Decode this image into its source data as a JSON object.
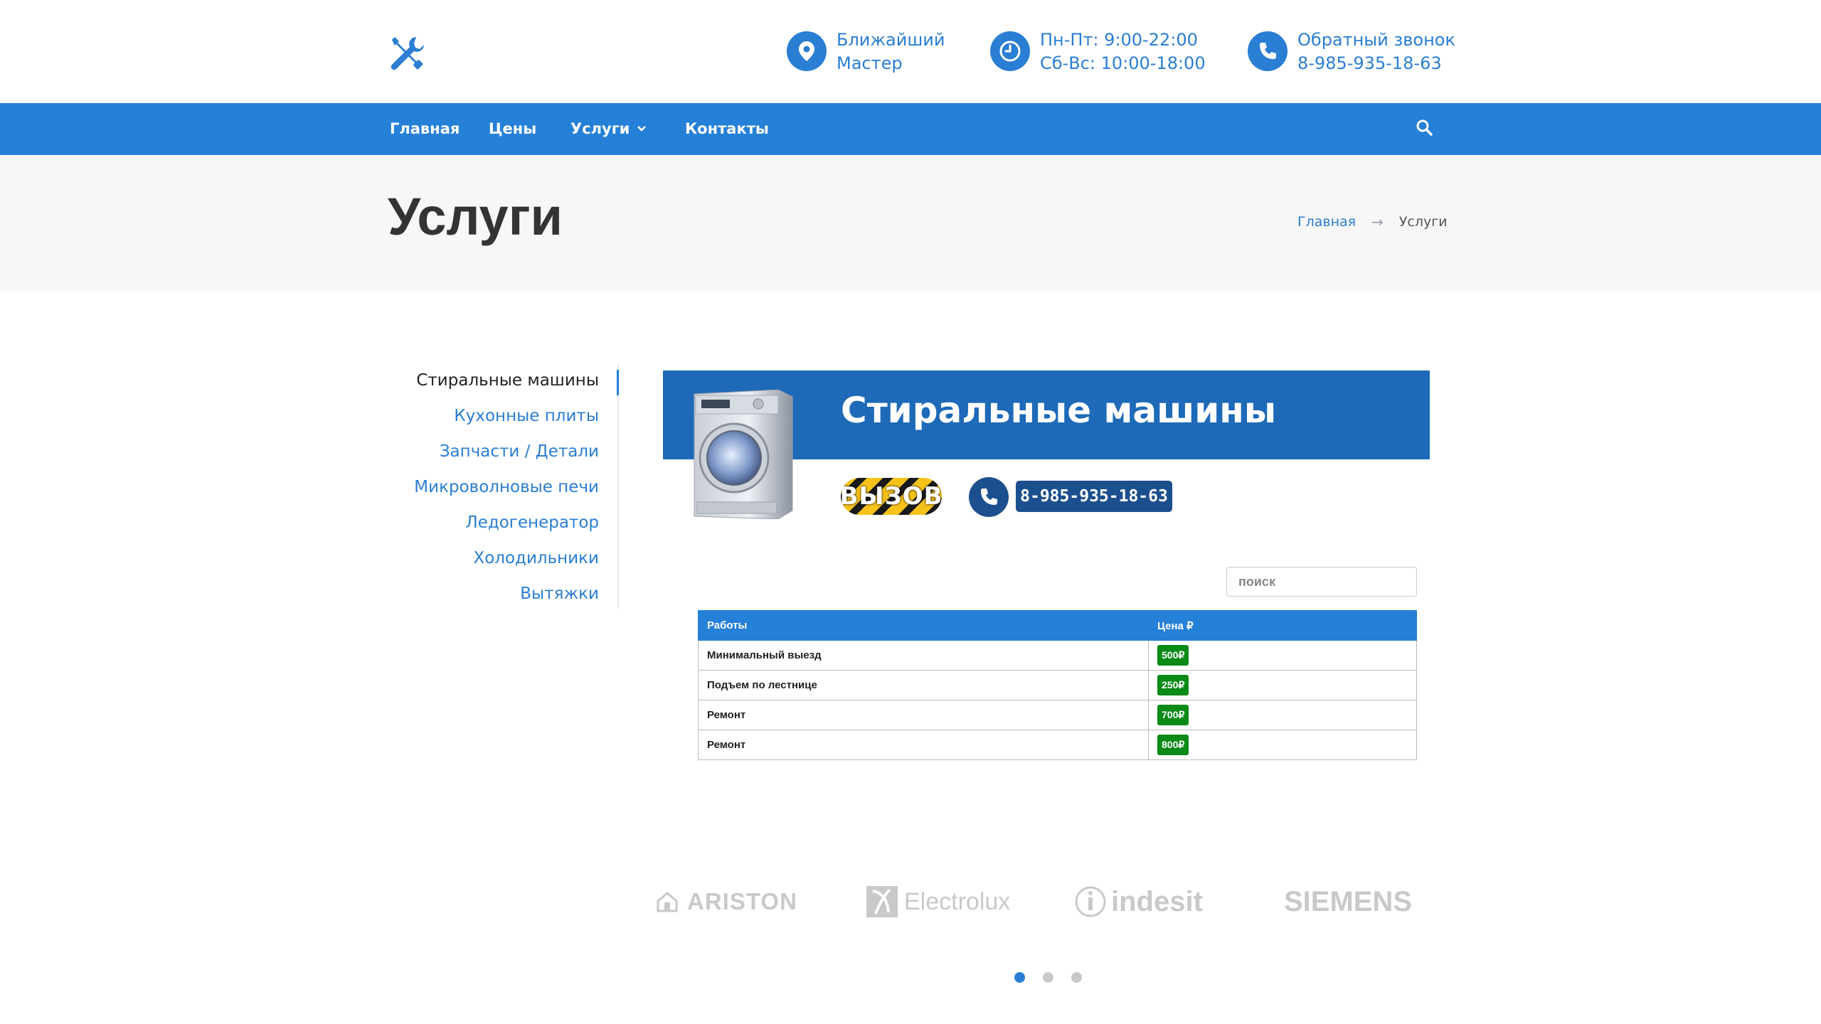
{
  "header": {
    "logo_icon": "tools-icon",
    "nearest": {
      "line1": "Ближайший",
      "line2": "Мастер",
      "icon": "map-pin-icon"
    },
    "hours": {
      "line1": "Пн-Пт: 9:00-22:00",
      "line2": "Сб-Вс: 10:00-18:00",
      "icon": "clock-icon"
    },
    "callback": {
      "line1": "Обратный звонок",
      "line2": "8-985-935-18-63",
      "icon": "phone-icon"
    }
  },
  "nav": {
    "items": [
      "Главная",
      "Цены",
      "Услуги",
      "Контакты"
    ],
    "search_icon": "search-icon"
  },
  "page": {
    "title": "Услуги",
    "breadcrumb": {
      "home": "Главная",
      "separator": "→",
      "current": "Услуги"
    }
  },
  "sidebar": {
    "items": [
      {
        "label": "Стиральные машины",
        "active": true
      },
      {
        "label": "Кухонные плиты"
      },
      {
        "label": "Запчасти / Детали"
      },
      {
        "label": "Микроволновые печи"
      },
      {
        "label": "Ледогенератор"
      },
      {
        "label": "Холодильники"
      },
      {
        "label": "Вытяжки"
      }
    ]
  },
  "banner": {
    "title": "Стиральные машины",
    "call_label": "ВЫЗОВ",
    "phone": "8-985-935-18-63"
  },
  "table": {
    "search_placeholder": "поиск",
    "headers": [
      "Работы",
      "Цена ₽"
    ],
    "rows": [
      {
        "work": "Минимальный выезд",
        "price": "500₽"
      },
      {
        "work": "Подъем по лестнице",
        "price": "250₽"
      },
      {
        "work": "Ремонт",
        "price": "700₽"
      },
      {
        "work": "Ремонт",
        "price": "800₽"
      }
    ]
  },
  "brands": [
    "ARISTON",
    "Electrolux",
    "indesit",
    "SIEMENS"
  ],
  "carousel": {
    "pages": 3,
    "active": 1
  },
  "colors": {
    "accent": "#2580d8",
    "price_badge": "#0a8a16",
    "banner": "#1e6ab8"
  }
}
